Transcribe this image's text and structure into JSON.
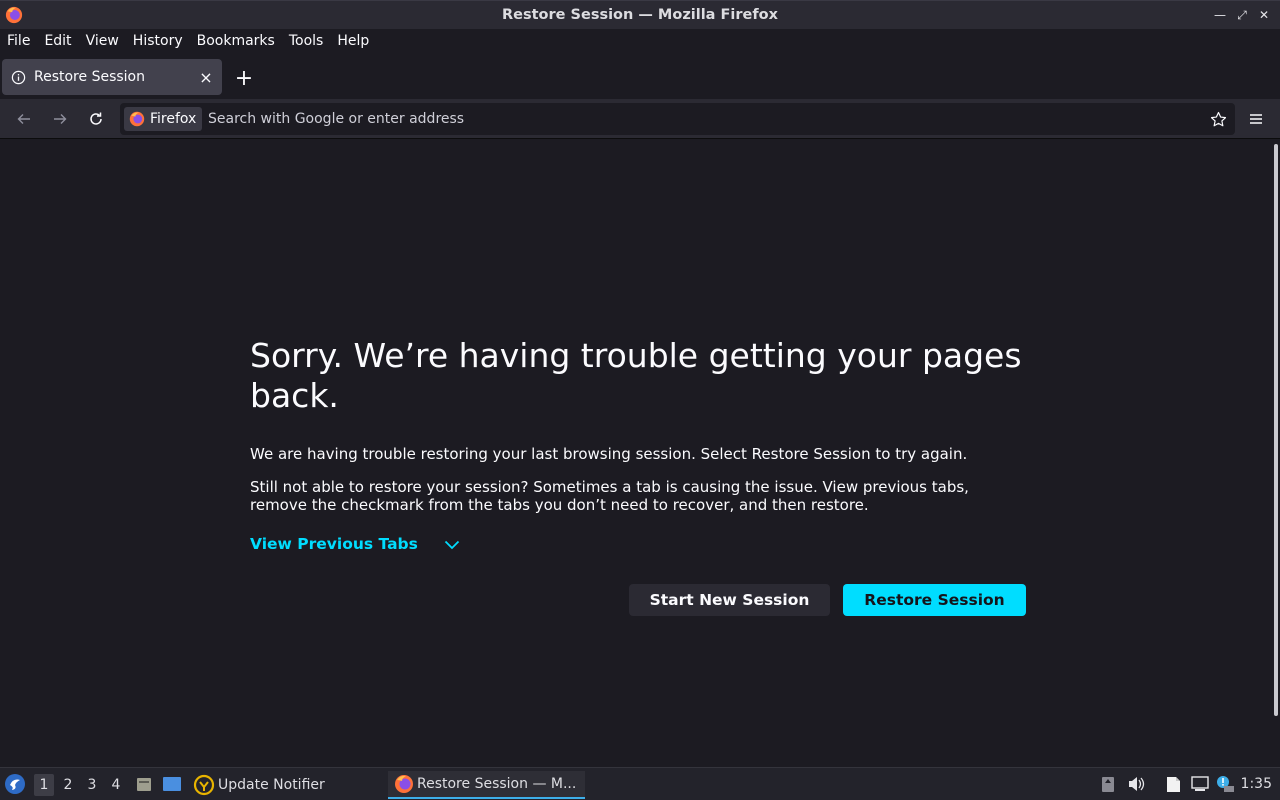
{
  "window": {
    "title": "Restore Session — Mozilla Firefox"
  },
  "menubar": {
    "items": [
      "File",
      "Edit",
      "View",
      "History",
      "Bookmarks",
      "Tools",
      "Help"
    ]
  },
  "tabs": [
    {
      "label": "Restore Session"
    }
  ],
  "navbar": {
    "identity_label": "Firefox",
    "url_placeholder": "Search with Google or enter address"
  },
  "page": {
    "headline": "Sorry. We’re having trouble getting your pages back.",
    "paragraph1": "We are having trouble restoring your last browsing session. Select Restore Session to try again.",
    "paragraph2": "Still not able to restore your session? Sometimes a tab is causing the issue. View previous tabs, remove the checkmark from the tabs you don’t need to recover, and then restore.",
    "view_previous_tabs": "View Previous Tabs",
    "start_new_session": "Start New Session",
    "restore_session": "Restore Session"
  },
  "taskbar": {
    "workspaces": [
      "1",
      "2",
      "3",
      "4"
    ],
    "active_workspace": "1",
    "apps": [
      {
        "label": "Update Notifier"
      },
      {
        "label": "Restore Session — M..."
      }
    ],
    "clock": "1:35"
  },
  "colors": {
    "accent": "#00ddff",
    "background": "#1c1b22",
    "toolbar": "#2b2a33"
  }
}
